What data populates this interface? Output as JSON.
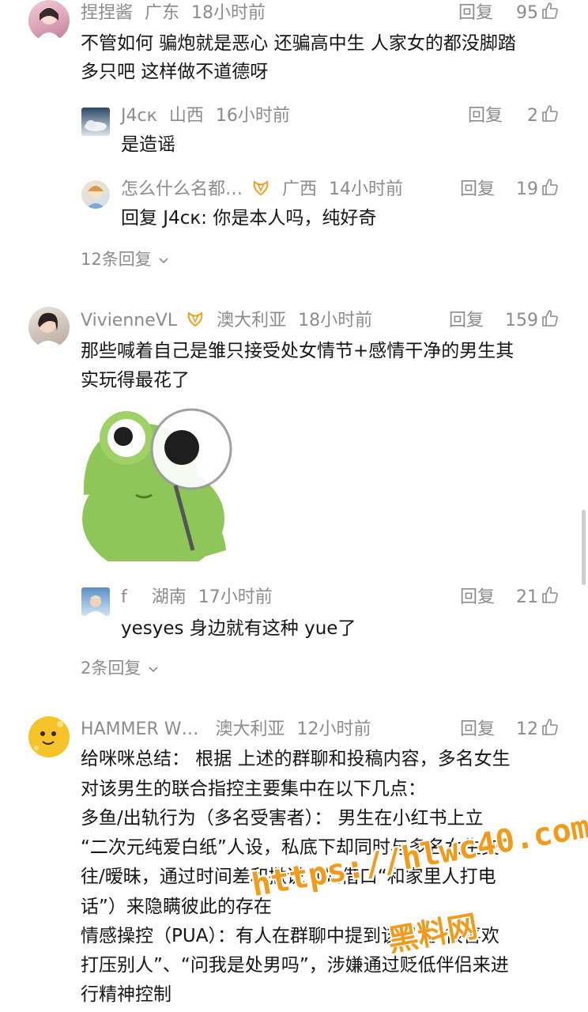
{
  "comments": [
    {
      "user": "捏捏酱",
      "location": "广东",
      "time": "18小时前",
      "reply": "回复",
      "likes": "95",
      "lines": [
        "不管如何 骗炮就是恶心 还骗高中生 人家女的都没脚踏",
        "多只吧 这样做不道德呀"
      ],
      "replies": [
        {
          "user": "J4ск",
          "location": "山西",
          "time": "16小时前",
          "reply": "回复",
          "likes": "2",
          "text": "是造谣"
        },
        {
          "user": "怎么什么名都…",
          "location": "广西",
          "time": "14小时前",
          "reply": "回复",
          "likes": "19",
          "text": "回复 J4ск: 你是本人吗，纯好奇"
        }
      ],
      "more": "12条回复"
    },
    {
      "user": "VivienneVL",
      "location": "澳大利亚",
      "time": "18小时前",
      "reply": "回复",
      "likes": "159",
      "lines": [
        "那些喊着自己是雏只接受处女情节+感情干净的男生其",
        "实玩得最花了"
      ],
      "sticker": "frog-magnifier-sticker",
      "replies": [
        {
          "user": "f",
          "location": "湖南",
          "time": "17小时前",
          "reply": "回复",
          "likes": "21",
          "text": "yesyes 身边就有这种 yue了"
        }
      ],
      "more": "2条回复"
    },
    {
      "user": "HAMMER W…",
      "location": "澳大利亚",
      "time": "12小时前",
      "reply": "回复",
      "likes": "12",
      "lines": [
        "给咪咪总结： 根据 上述的群聊和投稿内容，多名女生",
        "对该男生的联合指控主要集中在以下几点：",
        " 多鱼/出轨行为（多名受害者）： 男生在小红书上立",
        "“二次元纯爱白纸”人设，私底下却同时与多名女生交",
        "往/暧昧，通过时间差和撒谎（如借口“和家里人打电",
        "话”）来隐瞒彼此的存在",
        " 情感操控（PUA）：有人在群聊中提到该男生“很喜欢",
        "打压别人”、“问我是处男吗”，涉嫌通过贬低伴侣来进",
        "行精神控制"
      ]
    }
  ],
  "watermark": {
    "url": "https://hlwc40.com",
    "name": "黑料网"
  },
  "colors": {
    "meta": "#8c8c8c",
    "text": "#151515",
    "watermark": "#f29a1a",
    "badge": "#f0a020"
  }
}
